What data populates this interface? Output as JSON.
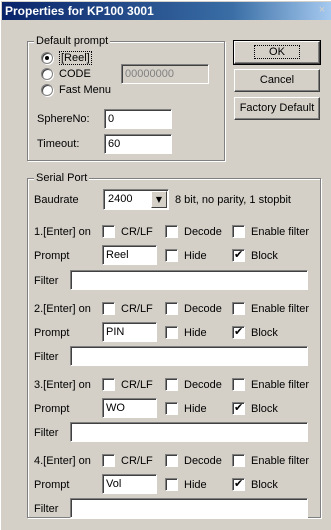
{
  "window": {
    "title": "Properties for KP100 3001",
    "close_glyph": "×"
  },
  "default_prompt": {
    "label": "Default prompt",
    "options": [
      {
        "label": "[Reel]",
        "selected": true
      },
      {
        "label": "CODE",
        "selected": false
      },
      {
        "label": "Fast Menu",
        "selected": false
      }
    ],
    "code_value": "00000000",
    "sphere_label": "SphereNo:",
    "sphere_value": "0",
    "timeout_label": "Timeout:",
    "timeout_value": "60"
  },
  "buttons": {
    "ok": "OK",
    "cancel": "Cancel",
    "factory_default": "Factory Default"
  },
  "serial_port": {
    "label": "Serial Port",
    "baudrate_label": "Baudrate",
    "baudrate_value": "2400",
    "baudrate_info": "8 bit, no parity, 1 stopbit",
    "cr_lf_label": "CR/LF",
    "decode_label": "Decode",
    "enable_filter_label": "Enable filter",
    "prompt_label": "Prompt",
    "hide_label": "Hide",
    "block_label": "Block",
    "filter_label": "Filter",
    "entries": [
      {
        "on_label": "1.[Enter] on",
        "prompt_value": "Reel",
        "filter_value": "",
        "cr_lf": false,
        "decode": false,
        "enable_filter": false,
        "hide": false,
        "block": true
      },
      {
        "on_label": "2.[Enter] on",
        "prompt_value": "PIN",
        "filter_value": "",
        "cr_lf": false,
        "decode": false,
        "enable_filter": false,
        "hide": false,
        "block": true
      },
      {
        "on_label": "3.[Enter] on",
        "prompt_value": "WO",
        "filter_value": "",
        "cr_lf": false,
        "decode": false,
        "enable_filter": false,
        "hide": false,
        "block": true
      },
      {
        "on_label": "4.[Enter] on",
        "prompt_value": "Vol",
        "filter_value": "",
        "cr_lf": false,
        "decode": false,
        "enable_filter": false,
        "hide": false,
        "block": true
      }
    ]
  },
  "colors": {
    "titlebar_start": "#0a246a",
    "titlebar_end": "#a6caf0",
    "face": "#d4d0c8"
  }
}
